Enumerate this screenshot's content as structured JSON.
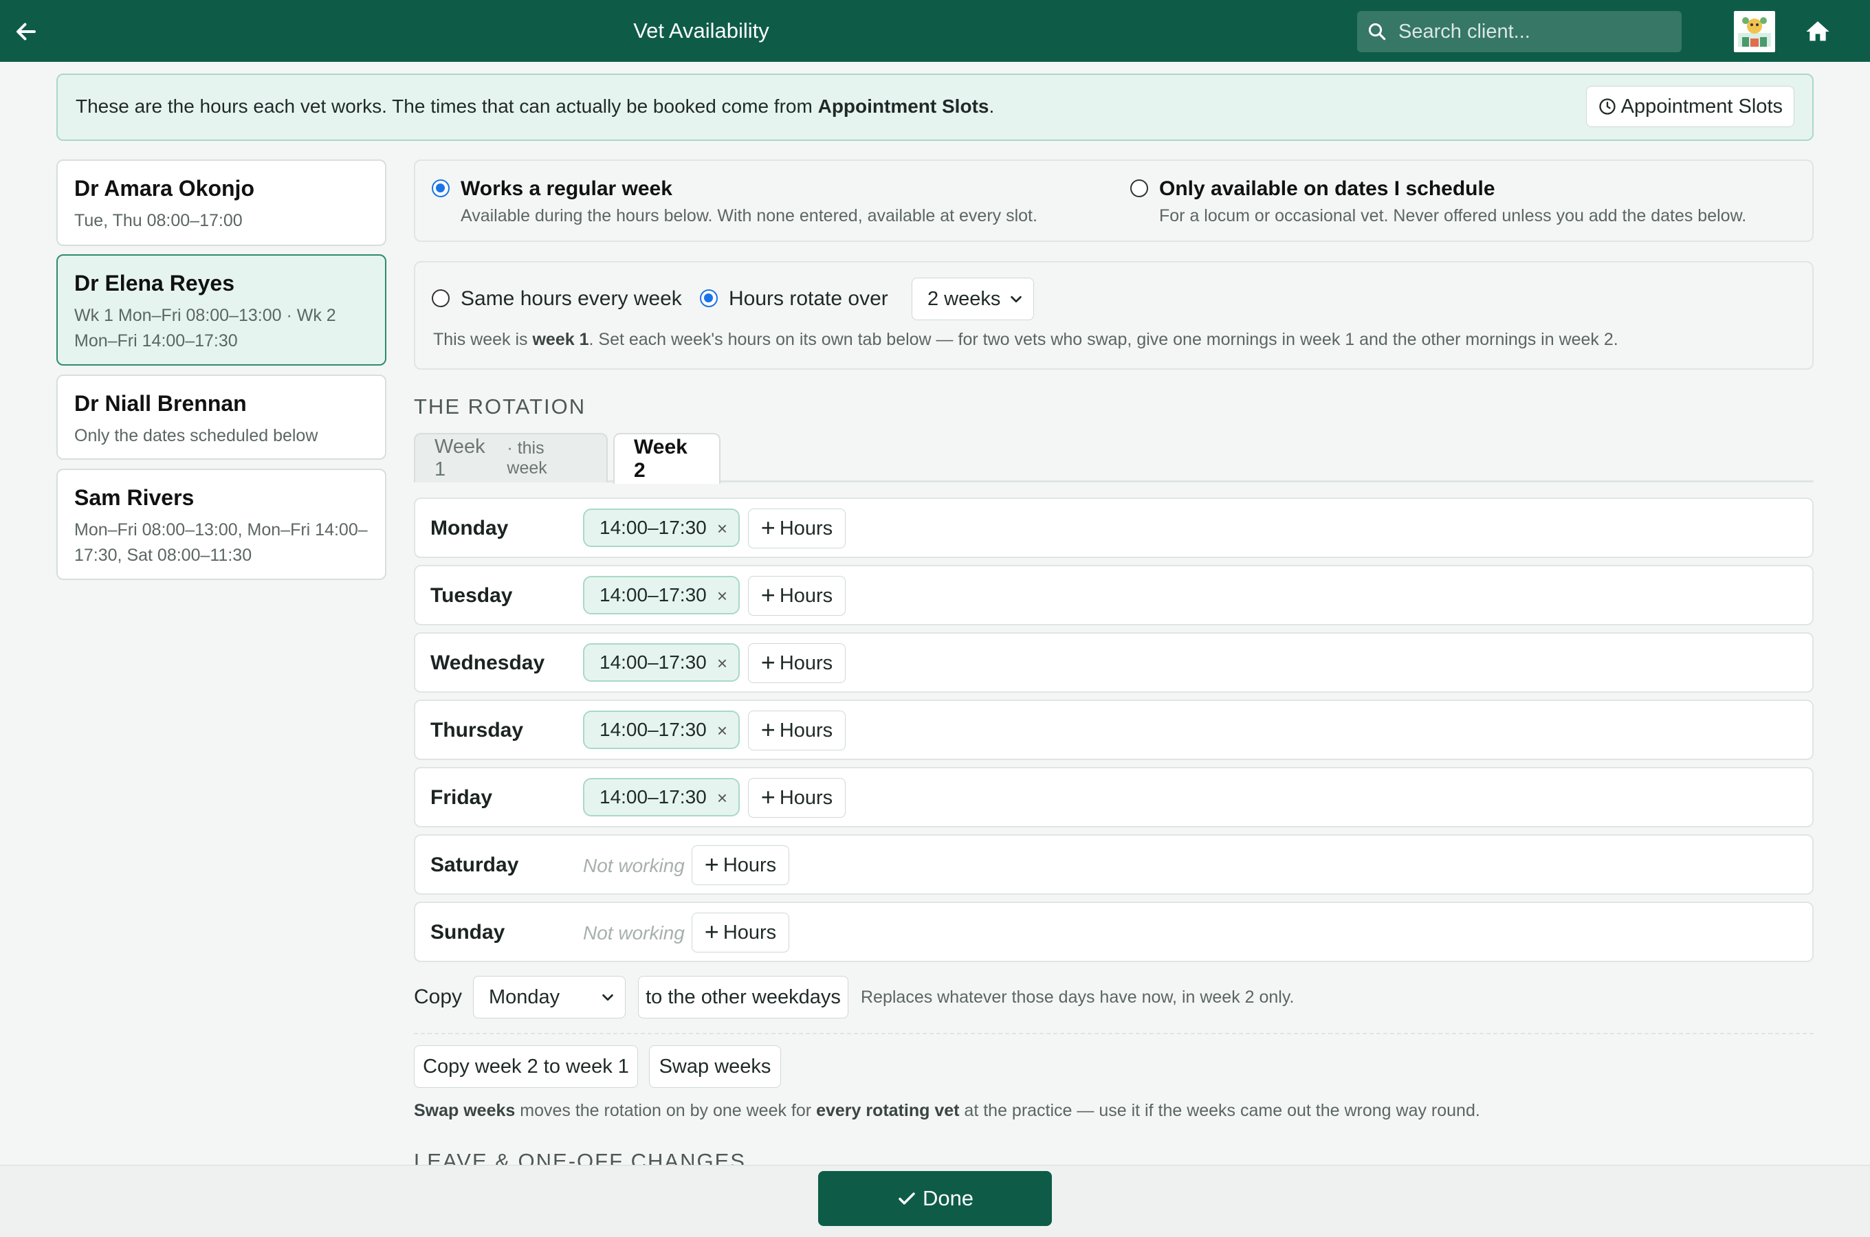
{
  "header": {
    "title": "Vet Availability",
    "search_placeholder": "Search client..."
  },
  "banner": {
    "text_before": "These are the hours each vet works. The times that can actually be booked come from ",
    "link_text": "Appointment Slots",
    "text_after": ".",
    "button_label": "Appointment Slots"
  },
  "vets": [
    {
      "name": "Dr Amara Okonjo",
      "hours": "Tue, Thu 08:00–17:00"
    },
    {
      "name": "Dr Elena Reyes",
      "hours": "Wk 1 Mon–Fri 08:00–13:00 · Wk 2 Mon–Fri 14:00–17:30"
    },
    {
      "name": "Dr Niall Brennan",
      "hours": "Only the dates scheduled below"
    },
    {
      "name": "Sam Rivers",
      "hours": "Mon–Fri 08:00–13:00, Mon–Fri 14:00–17:30, Sat 08:00–11:30"
    }
  ],
  "selected_vet": "Dr Elena Reyes",
  "availability_mode": {
    "regular": {
      "title": "Works a regular week",
      "subtitle": "Available during the hours below. With none entered, available at every slot.",
      "selected": true
    },
    "scheduled": {
      "title": "Only available on dates I schedule",
      "subtitle": "For a locum or occasional vet. Never offered unless you add the dates below.",
      "selected": false
    }
  },
  "rotation_mode": {
    "same_label": "Same hours every week",
    "rotate_label": "Hours rotate over",
    "rotate_selected": true,
    "rotate_value": "2 weeks",
    "note_before": "This week is ",
    "note_bold": "week 1",
    "note_after": ". Set each week's hours on its own tab below — for two vets who swap, give one mornings in week 1 and the other mornings in week 2."
  },
  "rotation": {
    "heading": "THE ROTATION",
    "tabs": [
      {
        "label": "Week 1",
        "suffix": "· this week",
        "active": false
      },
      {
        "label": "Week 2",
        "suffix": "",
        "active": true
      }
    ]
  },
  "days": [
    {
      "name": "Monday",
      "slots": [
        "14:00–17:30"
      ],
      "not_working": ""
    },
    {
      "name": "Tuesday",
      "slots": [
        "14:00–17:30"
      ],
      "not_working": ""
    },
    {
      "name": "Wednesday",
      "slots": [
        "14:00–17:30"
      ],
      "not_working": ""
    },
    {
      "name": "Thursday",
      "slots": [
        "14:00–17:30"
      ],
      "not_working": ""
    },
    {
      "name": "Friday",
      "slots": [
        "14:00–17:30"
      ],
      "not_working": ""
    },
    {
      "name": "Saturday",
      "slots": [],
      "not_working": "Not working"
    },
    {
      "name": "Sunday",
      "slots": [],
      "not_working": "Not working"
    }
  ],
  "add_hours_label": "Hours",
  "copy": {
    "label": "Copy",
    "day_value": "Monday",
    "button": "to the other weekdays",
    "note": "Replaces whatever those days have now, in week 2 only."
  },
  "week_actions": {
    "copy_week": "Copy week 2 to week 1",
    "swap": "Swap weeks",
    "note_b1": "Swap weeks",
    "note_t1": " moves the rotation on by one week for ",
    "note_b2": "every rotating vet",
    "note_t2": " at the practice — use it if the weeks came out the wrong way round."
  },
  "leave_heading": "LEAVE & ONE-OFF CHANGES",
  "footer": {
    "done_label": "Done"
  },
  "colors": {
    "primary": "#0e5c48",
    "accent_bg": "#e6f4ef",
    "accent_border": "#a9d9c6",
    "radio": "#1a73e8"
  }
}
